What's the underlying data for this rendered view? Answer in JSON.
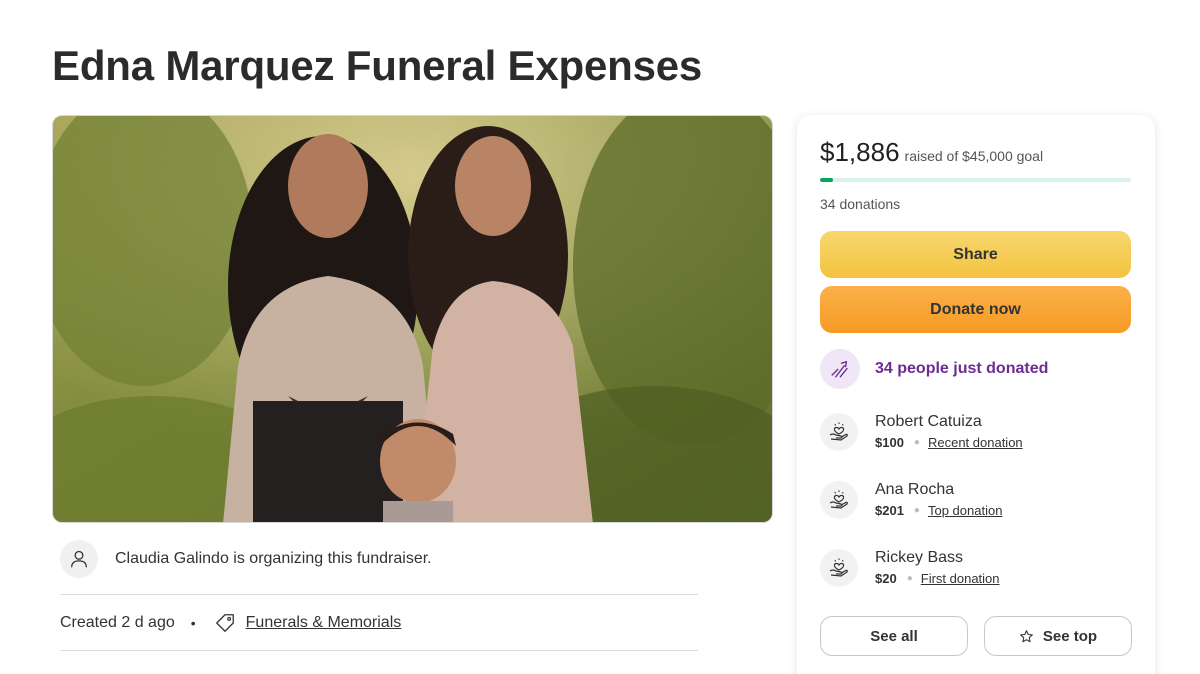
{
  "page": {
    "title": "Edna Marquez Funeral Expenses"
  },
  "organizer": {
    "text": "Claudia Galindo is organizing this fundraiser."
  },
  "meta": {
    "created": "Created 2 d ago",
    "bullet": "•",
    "category": "Funerals & Memorials"
  },
  "donation_panel": {
    "raised_amount": "$1,886",
    "goal_text": "raised of $45,000 goal",
    "progress_fraction": 0.042,
    "donations_count": "34 donations",
    "share_label": "Share",
    "donate_label": "Donate now",
    "momentum_text": "34 people just donated",
    "donors": [
      {
        "name": "Robert Catuiza",
        "amount": "$100",
        "type": "Recent donation"
      },
      {
        "name": "Ana Rocha",
        "amount": "$201",
        "type": "Top donation"
      },
      {
        "name": "Rickey Bass",
        "amount": "$20",
        "type": "First donation"
      }
    ],
    "see_all_label": "See all",
    "see_top_label": "See top"
  },
  "colors": {
    "progress_fill": "#02a95c",
    "progress_track": "#d9f2ea",
    "share_button": "#f3c33f",
    "donate_button": "#f59a24",
    "momentum_text": "#6d2c91"
  },
  "icons": {
    "organizer": "user-icon",
    "category": "tag-icon",
    "momentum": "trending-up-icon",
    "donor": "heart-hand-icon",
    "see_top": "star-icon"
  }
}
